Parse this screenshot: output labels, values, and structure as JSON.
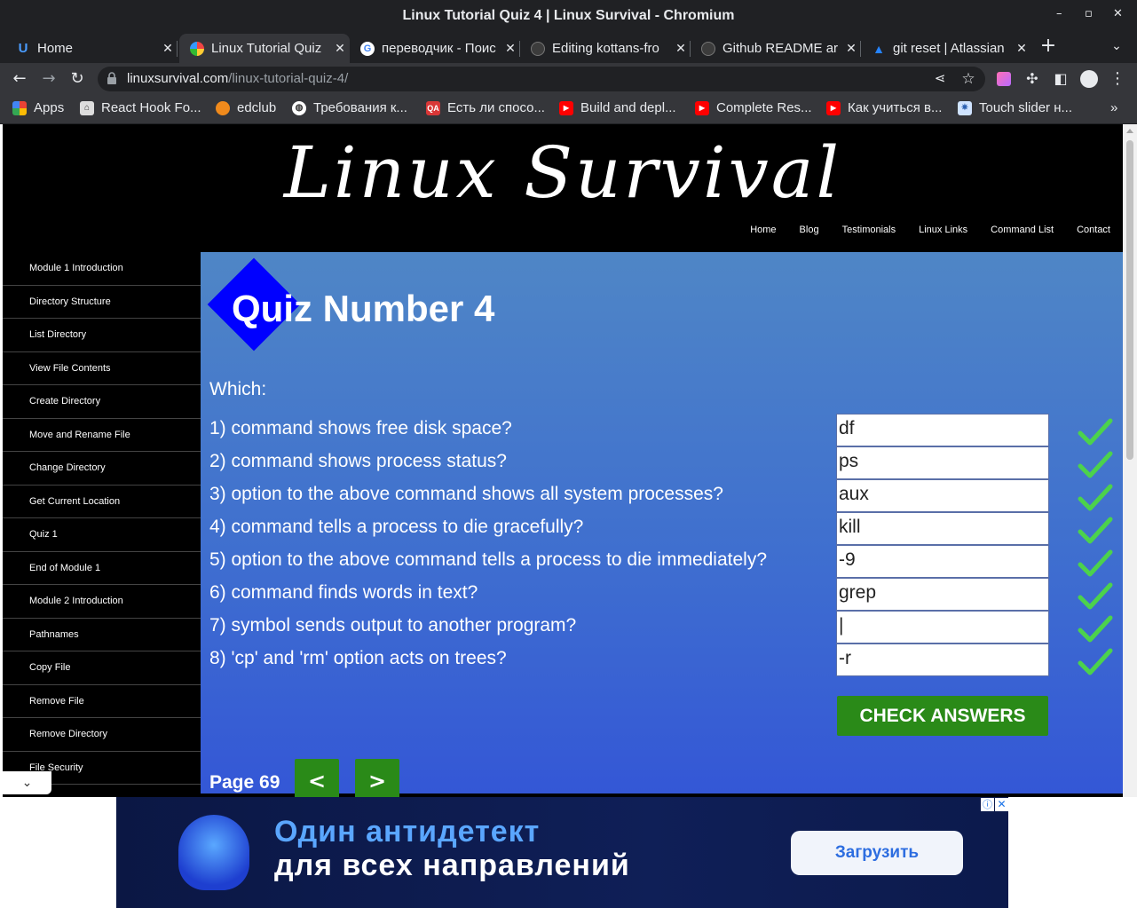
{
  "window": {
    "title": "Linux Tutorial Quiz 4 | Linux Survival - Chromium"
  },
  "tabs": [
    {
      "label": "Home",
      "icon": "u-icon"
    },
    {
      "label": "Linux Tutorial Quiz",
      "icon": "linuxsurvival-icon"
    },
    {
      "label": "переводчик - Поис",
      "icon": "google-icon"
    },
    {
      "label": "Editing kottans-fro",
      "icon": "github-icon"
    },
    {
      "label": "Github README ar",
      "icon": "github-icon"
    },
    {
      "label": "git reset | Atlassian",
      "icon": "atlassian-icon"
    }
  ],
  "omnibox": {
    "host": "linuxsurvival.com",
    "path": "/linux-tutorial-quiz-4/"
  },
  "bookmarks": [
    {
      "label": "Apps"
    },
    {
      "label": "React Hook Fo..."
    },
    {
      "label": "edclub"
    },
    {
      "label": "Требования к..."
    },
    {
      "label": "Есть ли спосо..."
    },
    {
      "label": "Build and depl..."
    },
    {
      "label": "Complete Res..."
    },
    {
      "label": "Как учиться в..."
    },
    {
      "label": "Touch slider н..."
    }
  ],
  "site": {
    "logo": "Linux Survival",
    "nav": [
      "Home",
      "Blog",
      "Testimonials",
      "Linux Links",
      "Command List",
      "Contact"
    ],
    "sidebar": [
      "Module 1 Introduction",
      "Directory Structure",
      "List Directory",
      "View File Contents",
      "Create Directory",
      "Move and Rename File",
      "Change Directory",
      "Get Current Location",
      "Quiz 1",
      "End of Module 1",
      "Module 2 Introduction",
      "Pathnames",
      "Copy File",
      "Remove File",
      "Remove Directory",
      "File Security"
    ]
  },
  "quiz": {
    "title": "Quiz Number 4",
    "prompt": "Which:",
    "questions": [
      {
        "text": "1) command shows free disk space?",
        "answer": "df",
        "correct": true
      },
      {
        "text": "2) command shows process status?",
        "answer": "ps",
        "correct": true
      },
      {
        "text": "3) option to the above command shows all system processes?",
        "answer": "aux",
        "correct": true
      },
      {
        "text": "4) command tells a process to die gracefully?",
        "answer": "kill",
        "correct": true
      },
      {
        "text": "5) option to the above command tells a process to die immediately?",
        "answer": "-9",
        "correct": true
      },
      {
        "text": "6) command finds words in text?",
        "answer": "grep",
        "correct": true
      },
      {
        "text": "7) symbol sends output to another program?",
        "answer": "|",
        "correct": true
      },
      {
        "text": "8) 'cp' and 'rm' option acts on trees?",
        "answer": "-r",
        "correct": true
      }
    ],
    "check_label": "CHECK ANSWERS",
    "page_label": "Page 69",
    "prev_label": "<",
    "next_label": ">"
  },
  "ad": {
    "line1": "Один антидетект",
    "line2": "для всех направлений",
    "button": "Загрузить",
    "info": "ⓘ",
    "close": "✕"
  },
  "colors": {
    "accent_green": "#2a8a18",
    "check_green": "#4cd24c",
    "quiz_blue": "#3f6fcf",
    "diamond": "#0000ff"
  }
}
